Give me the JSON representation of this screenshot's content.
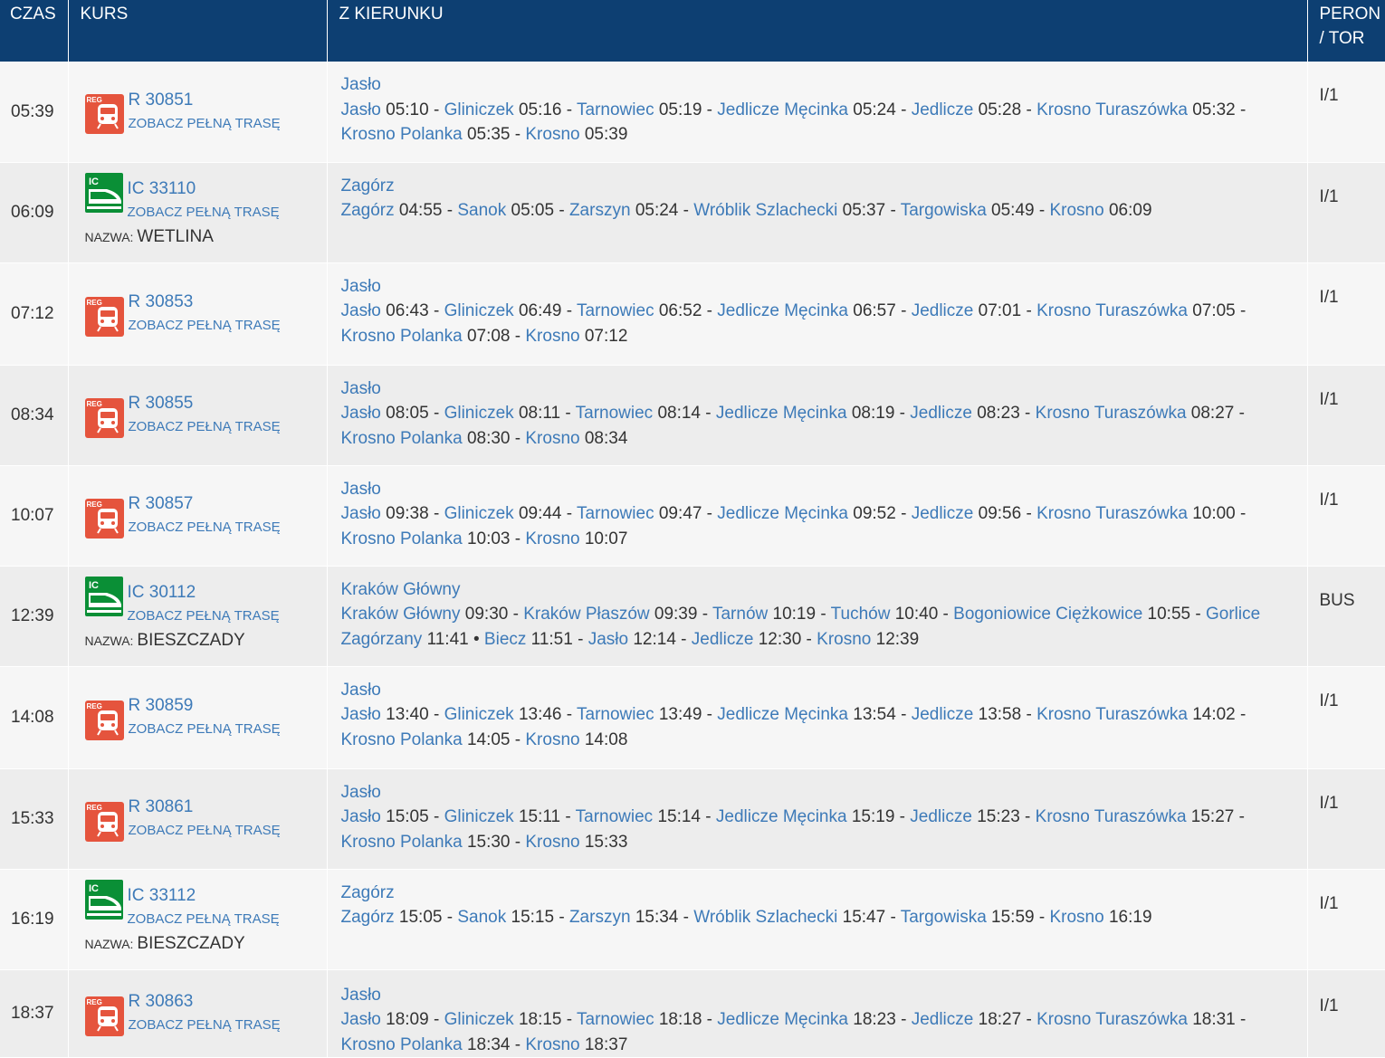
{
  "colors": {
    "header_bg": "#0d3f72",
    "link": "#3d7ab8",
    "reg_icon": "#e5543d",
    "ic_icon": "#0a8f36"
  },
  "header": {
    "time": "CZAS",
    "course": "KURS",
    "from": "Z KIERUNKU",
    "platform_line1": "PERON",
    "platform_line2": "/ TOR"
  },
  "labels": {
    "full_route": "ZOBACZ PEŁNĄ TRASĘ",
    "name": "NAZWA:",
    "reg_icon_letters": "REG",
    "ic_icon_letters": "IC"
  },
  "rows": [
    {
      "time": "05:39",
      "carrier": "reg",
      "course": "R 30851",
      "name": "",
      "platform": "I/1",
      "origin": "Jasło",
      "stops": [
        {
          "station": "Jasło",
          "time": "05:10"
        },
        {
          "station": "Gliniczek",
          "time": "05:16"
        },
        {
          "station": "Tarnowiec",
          "time": "05:19"
        },
        {
          "station": "Jedlicze Męcinka",
          "time": "05:24"
        },
        {
          "station": "Jedlicze",
          "time": "05:28"
        },
        {
          "station": "Krosno Turaszówka",
          "time": "05:32"
        },
        {
          "station": "Krosno Polanka",
          "time": "05:35"
        },
        {
          "station": "Krosno",
          "time": "05:39"
        }
      ]
    },
    {
      "time": "06:09",
      "carrier": "ic",
      "course": "IC 33110",
      "name": "WETLINA",
      "platform": "I/1",
      "origin": "Zagórz",
      "stops": [
        {
          "station": "Zagórz",
          "time": "04:55"
        },
        {
          "station": "Sanok",
          "time": "05:05"
        },
        {
          "station": "Zarszyn",
          "time": "05:24"
        },
        {
          "station": "Wróblik Szlachecki",
          "time": "05:37"
        },
        {
          "station": "Targowiska",
          "time": "05:49"
        },
        {
          "station": "Krosno",
          "time": "06:09"
        }
      ]
    },
    {
      "time": "07:12",
      "carrier": "reg",
      "course": "R 30853",
      "name": "",
      "platform": "I/1",
      "origin": "Jasło",
      "stops": [
        {
          "station": "Jasło",
          "time": "06:43"
        },
        {
          "station": "Gliniczek",
          "time": "06:49"
        },
        {
          "station": "Tarnowiec",
          "time": "06:52"
        },
        {
          "station": "Jedlicze Męcinka",
          "time": "06:57"
        },
        {
          "station": "Jedlicze",
          "time": "07:01"
        },
        {
          "station": "Krosno Turaszówka",
          "time": "07:05"
        },
        {
          "station": "Krosno Polanka",
          "time": "07:08"
        },
        {
          "station": "Krosno",
          "time": "07:12"
        }
      ]
    },
    {
      "time": "08:34",
      "carrier": "reg",
      "course": "R 30855",
      "name": "",
      "platform": "I/1",
      "origin": "Jasło",
      "stops": [
        {
          "station": "Jasło",
          "time": "08:05"
        },
        {
          "station": "Gliniczek",
          "time": "08:11"
        },
        {
          "station": "Tarnowiec",
          "time": "08:14"
        },
        {
          "station": "Jedlicze Męcinka",
          "time": "08:19"
        },
        {
          "station": "Jedlicze",
          "time": "08:23"
        },
        {
          "station": "Krosno Turaszówka",
          "time": "08:27"
        },
        {
          "station": "Krosno Polanka",
          "time": "08:30"
        },
        {
          "station": "Krosno",
          "time": "08:34"
        }
      ]
    },
    {
      "time": "10:07",
      "carrier": "reg",
      "course": "R 30857",
      "name": "",
      "platform": "I/1",
      "origin": "Jasło",
      "stops": [
        {
          "station": "Jasło",
          "time": "09:38"
        },
        {
          "station": "Gliniczek",
          "time": "09:44"
        },
        {
          "station": "Tarnowiec",
          "time": "09:47"
        },
        {
          "station": "Jedlicze Męcinka",
          "time": "09:52"
        },
        {
          "station": "Jedlicze",
          "time": "09:56"
        },
        {
          "station": "Krosno Turaszówka",
          "time": "10:00"
        },
        {
          "station": "Krosno Polanka",
          "time": "10:03"
        },
        {
          "station": "Krosno",
          "time": "10:07"
        }
      ]
    },
    {
      "time": "12:39",
      "carrier": "ic",
      "course": "IC 30112",
      "name": "BIESZCZADY",
      "platform": "BUS",
      "origin": "Kraków Główny",
      "stops": [
        {
          "station": "Kraków Główny",
          "time": "09:30"
        },
        {
          "station": "Kraków Płaszów",
          "time": "09:39"
        },
        {
          "station": "Tarnów",
          "time": "10:19"
        },
        {
          "station": "Tuchów",
          "time": "10:40"
        },
        {
          "station": "Bogoniowice Ciężkowice",
          "time": "10:55"
        },
        {
          "station": "Gorlice Zagórzany",
          "time": "11:41",
          "sep": "•"
        },
        {
          "station": "Biecz",
          "time": "11:51"
        },
        {
          "station": "Jasło",
          "time": "12:14"
        },
        {
          "station": "Jedlicze",
          "time": "12:30"
        },
        {
          "station": "Krosno",
          "time": "12:39"
        }
      ]
    },
    {
      "time": "14:08",
      "carrier": "reg",
      "course": "R 30859",
      "name": "",
      "platform": "I/1",
      "origin": "Jasło",
      "stops": [
        {
          "station": "Jasło",
          "time": "13:40"
        },
        {
          "station": "Gliniczek",
          "time": "13:46"
        },
        {
          "station": "Tarnowiec",
          "time": "13:49"
        },
        {
          "station": "Jedlicze Męcinka",
          "time": "13:54"
        },
        {
          "station": "Jedlicze",
          "time": "13:58"
        },
        {
          "station": "Krosno Turaszówka",
          "time": "14:02"
        },
        {
          "station": "Krosno Polanka",
          "time": "14:05"
        },
        {
          "station": "Krosno",
          "time": "14:08"
        }
      ]
    },
    {
      "time": "15:33",
      "carrier": "reg",
      "course": "R 30861",
      "name": "",
      "platform": "I/1",
      "origin": "Jasło",
      "stops": [
        {
          "station": "Jasło",
          "time": "15:05"
        },
        {
          "station": "Gliniczek",
          "time": "15:11"
        },
        {
          "station": "Tarnowiec",
          "time": "15:14"
        },
        {
          "station": "Jedlicze Męcinka",
          "time": "15:19"
        },
        {
          "station": "Jedlicze",
          "time": "15:23"
        },
        {
          "station": "Krosno Turaszówka",
          "time": "15:27"
        },
        {
          "station": "Krosno Polanka",
          "time": "15:30"
        },
        {
          "station": "Krosno",
          "time": "15:33"
        }
      ]
    },
    {
      "time": "16:19",
      "carrier": "ic",
      "course": "IC 33112",
      "name": "BIESZCZADY",
      "platform": "I/1",
      "origin": "Zagórz",
      "stops": [
        {
          "station": "Zagórz",
          "time": "15:05"
        },
        {
          "station": "Sanok",
          "time": "15:15"
        },
        {
          "station": "Zarszyn",
          "time": "15:34"
        },
        {
          "station": "Wróblik Szlachecki",
          "time": "15:47"
        },
        {
          "station": "Targowiska",
          "time": "15:59"
        },
        {
          "station": "Krosno",
          "time": "16:19"
        }
      ]
    },
    {
      "time": "18:37",
      "carrier": "reg",
      "course": "R 30863",
      "name": "",
      "platform": "I/1",
      "origin": "Jasło",
      "stops": [
        {
          "station": "Jasło",
          "time": "18:09"
        },
        {
          "station": "Gliniczek",
          "time": "18:15"
        },
        {
          "station": "Tarnowiec",
          "time": "18:18"
        },
        {
          "station": "Jedlicze Męcinka",
          "time": "18:23"
        },
        {
          "station": "Jedlicze",
          "time": "18:27"
        },
        {
          "station": "Krosno Turaszówka",
          "time": "18:31"
        },
        {
          "station": "Krosno Polanka",
          "time": "18:34"
        },
        {
          "station": "Krosno",
          "time": "18:37"
        }
      ]
    }
  ]
}
